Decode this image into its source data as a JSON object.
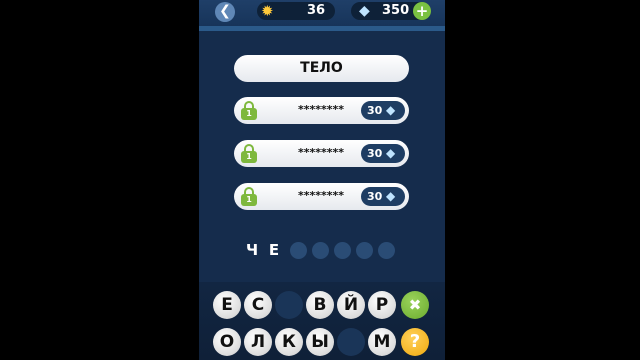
{
  "header": {
    "back_icon": "back-arrow-icon",
    "coins": "36",
    "coins_icon": "sun-icon",
    "gems": "350",
    "gems_icon": "diamond-icon",
    "add_icon": "plus-icon"
  },
  "word": "ТЕЛО",
  "hidden_words": [
    {
      "mask": "********",
      "cost": "30",
      "lock_level": "1"
    },
    {
      "mask": "********",
      "cost": "30",
      "lock_level": "1"
    },
    {
      "mask": "********",
      "cost": "30",
      "lock_level": "1"
    }
  ],
  "answer": {
    "letters": [
      "Ч",
      "Е"
    ],
    "empty_slots": 5
  },
  "keyboard": {
    "row1": [
      "Е",
      "С",
      "",
      "В",
      "Й",
      "Р"
    ],
    "row2": [
      "О",
      "Л",
      "К",
      "Ы",
      "",
      "М"
    ],
    "delete_icon": "close-icon",
    "hint_label": "?",
    "hint_icon": "question-icon"
  },
  "colors": {
    "background": "#152c4c",
    "accent_green": "#7eb83d",
    "hint_yellow": "#f0a90d"
  }
}
